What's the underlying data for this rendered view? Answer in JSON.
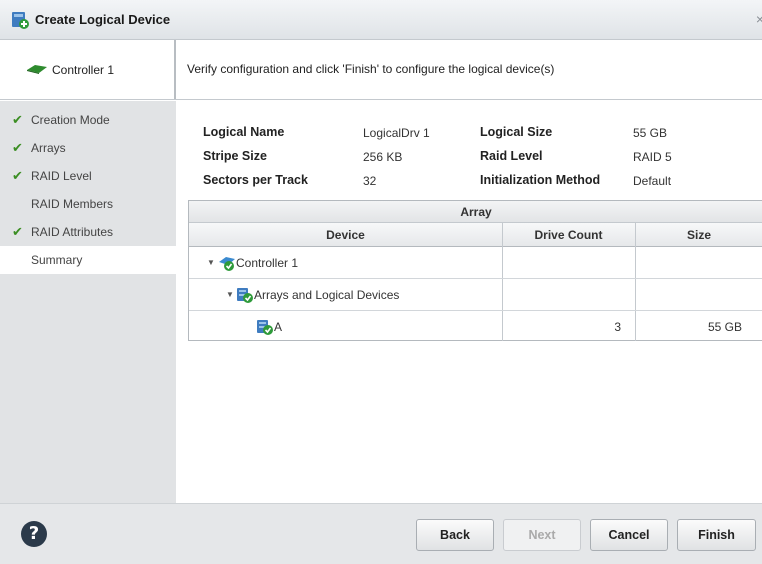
{
  "window": {
    "title": "Create Logical Device",
    "close_glyph": "×"
  },
  "controller_panel": {
    "label": "Controller 1"
  },
  "instruction": "Verify configuration and click 'Finish' to configure the logical device(s)",
  "sidebar": {
    "items": [
      {
        "label": "Creation Mode",
        "checked": true,
        "active": false
      },
      {
        "label": "Arrays",
        "checked": true,
        "active": false
      },
      {
        "label": "RAID Level",
        "checked": true,
        "active": false
      },
      {
        "label": "RAID Members",
        "checked": false,
        "active": false
      },
      {
        "label": "RAID Attributes",
        "checked": true,
        "active": false
      },
      {
        "label": "Summary",
        "checked": false,
        "active": true
      }
    ]
  },
  "summary": {
    "logical_name_label": "Logical Name",
    "logical_name_value": "LogicalDrv 1",
    "logical_size_label": "Logical Size",
    "logical_size_value": "55 GB",
    "stripe_size_label": "Stripe Size",
    "stripe_size_value": "256 KB",
    "raid_level_label": "Raid Level",
    "raid_level_value": "RAID 5",
    "sectors_label": "Sectors per Track",
    "sectors_value": "32",
    "init_label": "Initialization Method",
    "init_value": "Default"
  },
  "grid": {
    "group_header": "Array",
    "columns": {
      "device": "Device",
      "drive_count": "Drive Count",
      "size": "Size"
    },
    "rows": [
      {
        "device": "Controller 1",
        "drive_count": "",
        "size": ""
      },
      {
        "device": "Arrays and Logical Devices",
        "drive_count": "",
        "size": ""
      },
      {
        "device": "A",
        "drive_count": "3",
        "size": "55 GB"
      }
    ]
  },
  "buttons": {
    "help": "?",
    "back": "Back",
    "next": "Next",
    "cancel": "Cancel",
    "finish": "Finish"
  },
  "colors": {
    "accent_green": "#3b8e23",
    "sidebar_bg": "#e1e3e5",
    "footer_bg": "#e5e7e9"
  }
}
